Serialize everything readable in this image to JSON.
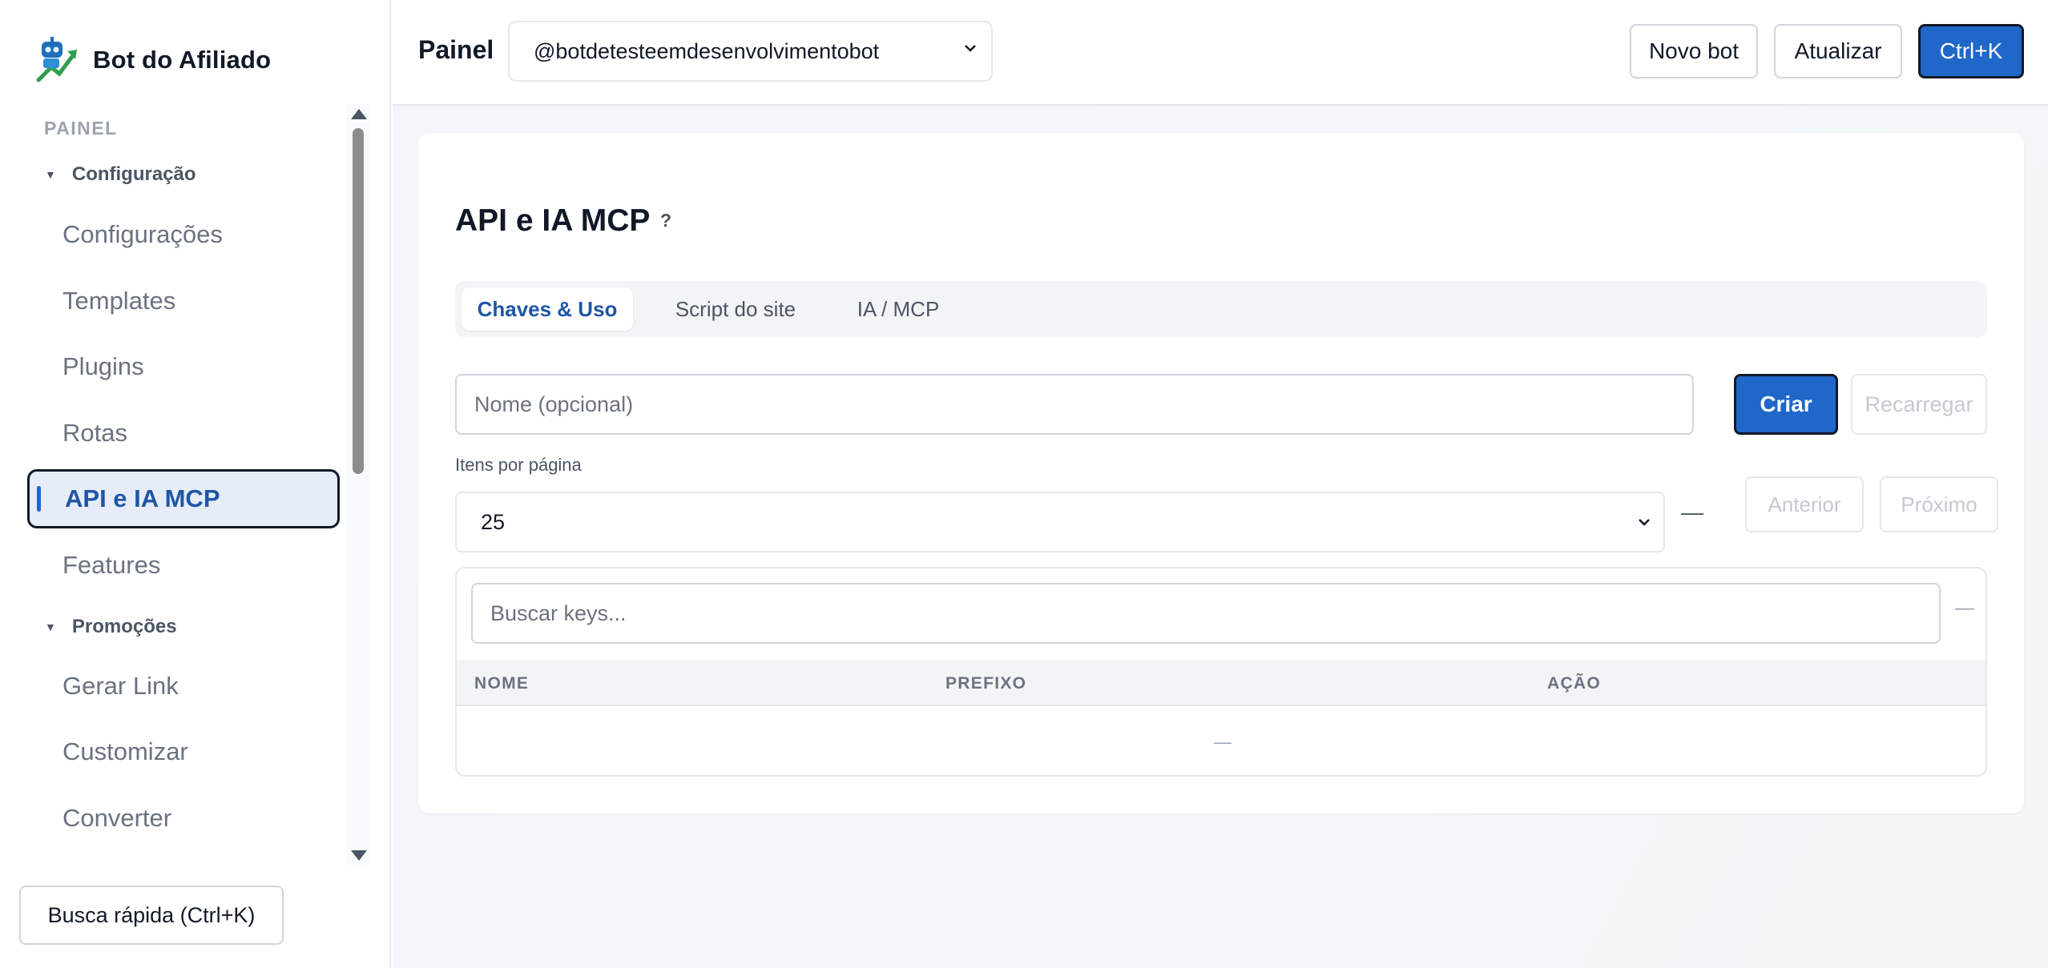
{
  "brand": {
    "name": "Bot do Afiliado"
  },
  "sidebar": {
    "section": "PAINEL",
    "groups": [
      {
        "label": "Configuração",
        "caret": "▼"
      },
      {
        "label": "Promoções",
        "caret": "▼"
      }
    ],
    "items": [
      {
        "label": "Configurações"
      },
      {
        "label": "Templates"
      },
      {
        "label": "Plugins"
      },
      {
        "label": "Rotas"
      },
      {
        "label": "API e IA MCP"
      },
      {
        "label": "Features"
      },
      {
        "label": "Gerar Link"
      },
      {
        "label": "Customizar"
      },
      {
        "label": "Converter"
      }
    ],
    "quick_search": "Busca rápida (Ctrl+K)"
  },
  "topbar": {
    "title": "Painel",
    "bot_select": "@botdetesteemdesenvolvimentobot",
    "buttons": {
      "new_bot": "Novo bot",
      "refresh": "Atualizar",
      "shortcut": "Ctrl+K"
    }
  },
  "main": {
    "title": "API e IA MCP",
    "help": "?",
    "tabs": [
      {
        "label": "Chaves & Uso"
      },
      {
        "label": "Script do site"
      },
      {
        "label": "IA / MCP"
      }
    ],
    "name_placeholder": "Nome (opcional)",
    "create_label": "Criar",
    "reload_label": "Recarregar",
    "per_page_label": "Itens por página",
    "per_page_value": "25",
    "page_indicator": "—",
    "prev_label": "Anterior",
    "next_label": "Próximo",
    "search_placeholder": "Buscar keys...",
    "search_count": "—",
    "table": {
      "headers": [
        "NOME",
        "PREFIXO",
        "AÇÃO"
      ],
      "empty": "—"
    }
  },
  "colors": {
    "accent": "#1f67c9",
    "active_bg": "#e6edf8",
    "active_text": "#1e56a6"
  }
}
